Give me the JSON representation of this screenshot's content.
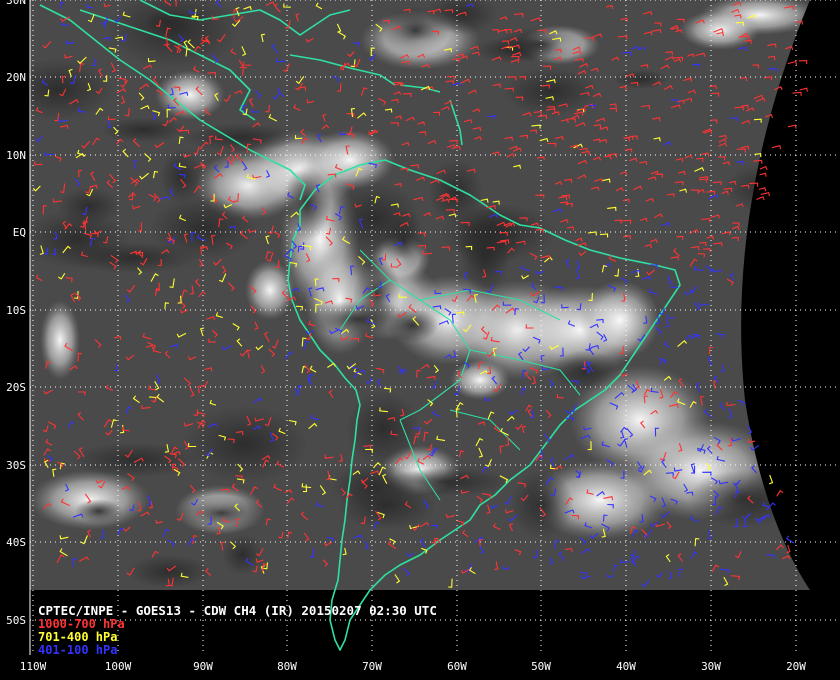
{
  "title": "CPTEC/INPE - GOES13 - CDW CH4 (IR) 20150207 02:30 UTC",
  "legend": [
    {
      "label": "1000-700 hPa",
      "color": "#ff3333"
    },
    {
      "label": "701-400 hPa",
      "color": "#ffff33"
    },
    {
      "label": "401-100 hPa",
      "color": "#3333ff"
    }
  ],
  "lat_labels": [
    "30N",
    "20N",
    "10N",
    "EQ",
    "10S",
    "20S",
    "30S",
    "40S",
    "50S"
  ],
  "lon_labels": [
    "110W",
    "100W",
    "90W",
    "80W",
    "70W",
    "60W",
    "50W",
    "40W",
    "30W",
    "20W"
  ],
  "colors": {
    "coastline": "#2fe0a0",
    "grid": "#ffffff",
    "background": "#000000",
    "label_text": "#ffffff"
  }
}
